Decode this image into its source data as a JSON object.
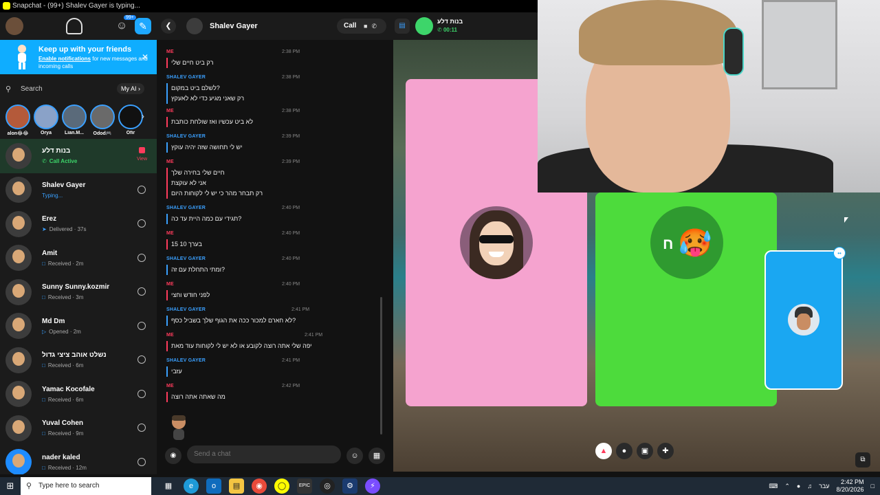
{
  "window": {
    "title": "Snapchat - (99+) Shalev Gayer is typing..."
  },
  "sidebar": {
    "badge": "99+",
    "notification": {
      "title": "Keep up with your friends",
      "link": "Enable notifications",
      "rest": " for new messages and incoming calls"
    },
    "search": {
      "placeholder": "Search",
      "myai": "My AI"
    },
    "stories": [
      {
        "name": "alon😂😂"
      },
      {
        "name": "Orya"
      },
      {
        "name": "Lian.M..."
      },
      {
        "name": "Odod🎮"
      },
      {
        "name": "Ofir"
      }
    ],
    "chats": [
      {
        "name": "בנות דלע",
        "status": "Call Active",
        "kind": "call",
        "view": "View"
      },
      {
        "name": "Shalev Gayer",
        "status": "Typing...",
        "kind": "typing"
      },
      {
        "name": "Erez",
        "status": "Delivered · 37s",
        "kind": "delivered"
      },
      {
        "name": "Amit",
        "status": "Received · 2m",
        "kind": "received"
      },
      {
        "name": "Sunny Sunny.kozmir",
        "status": "Received · 3m",
        "kind": "received"
      },
      {
        "name": "Md Dm",
        "status": "Opened · 2m",
        "kind": "opened"
      },
      {
        "name": "נשלט אוהב ציצי גדול",
        "status": "Received · 6m",
        "kind": "received"
      },
      {
        "name": "Yamac Kocofale",
        "status": "Received · 6m",
        "kind": "received"
      },
      {
        "name": "Yuval Cohen",
        "status": "Received · 9m",
        "kind": "received"
      },
      {
        "name": "nader kaled",
        "status": "Received · 12m",
        "kind": "received"
      }
    ]
  },
  "conversation": {
    "name": "Shalev Gayer",
    "call_label": "Call",
    "group_name": "בנות דלע",
    "group_time": "00:11",
    "composer_placeholder": "Send a chat",
    "messages": [
      {
        "sender": "ME",
        "who": "me",
        "time": "2:38 PM",
        "lines": [
          "רק ביט חיים שלי"
        ]
      },
      {
        "sender": "SHALEV GAYER",
        "who": "them",
        "time": "2:38 PM",
        "lines": [
          "לשלם ביט במקום?",
          "רק שאני מגיע כדי לא לאעקץ"
        ]
      },
      {
        "sender": "ME",
        "who": "me",
        "time": "2:38 PM",
        "lines": [
          "לא ביט עכשיו ואז שולחת כותבת"
        ]
      },
      {
        "sender": "SHALEV GAYER",
        "who": "them",
        "time": "2:39 PM",
        "lines": [
          "יש לי תחושה שזה יהיה עוקץ"
        ]
      },
      {
        "sender": "ME",
        "who": "me",
        "time": "2:39 PM",
        "lines": [
          "חיים שלי בחירה שלך",
          "אני לא עוקצת",
          "רק תבחר מהר כי יש לי לקוחות היום"
        ]
      },
      {
        "sender": "SHALEV GAYER",
        "who": "them",
        "time": "2:40 PM",
        "lines": [
          "תגידי עם כמה היית עד כה?"
        ]
      },
      {
        "sender": "ME",
        "who": "me",
        "time": "2:40 PM",
        "lines": [
          "בערך 10 15"
        ]
      },
      {
        "sender": "SHALEV GAYER",
        "who": "them",
        "time": "2:40 PM",
        "lines": [
          "ומתי התחלת עם זה?"
        ]
      },
      {
        "sender": "ME",
        "who": "me",
        "time": "2:40 PM",
        "lines": [
          "לפני חודש וחצי"
        ]
      },
      {
        "sender": "SHALEV GAYER",
        "who": "them",
        "time": "2:41 PM",
        "lines": [
          "לא חארם למכור ככה את הגוף שלך בשביל כסף?"
        ]
      },
      {
        "sender": "ME",
        "who": "me",
        "time": "2:41 PM",
        "lines": [
          "יפה שלי אתה רוצה לקובע או לא יש לי לקוחות עוד מאת"
        ]
      },
      {
        "sender": "SHALEV GAYER",
        "who": "them",
        "time": "2:41 PM",
        "lines": [
          "עזבי"
        ]
      },
      {
        "sender": "ME",
        "who": "me",
        "time": "2:42 PM",
        "lines": [
          "מה שאתה אתה רוצה"
        ]
      }
    ]
  },
  "call": {
    "tile_colors": {
      "pink": "#f5a3cf",
      "green": "#4ddb3c",
      "blue": "#1aa7f2"
    },
    "green_avatar_text": "ח"
  },
  "taskbar": {
    "search_placeholder": "Type here to search",
    "lang": "עבר",
    "time": "2:42 PM",
    "date": "8/20/2026"
  },
  "colors": {
    "snap_yellow": "#fffc00",
    "me_red": "#ff3b5c",
    "them_blue": "#3aa0ff",
    "call_green": "#3dd56a"
  }
}
